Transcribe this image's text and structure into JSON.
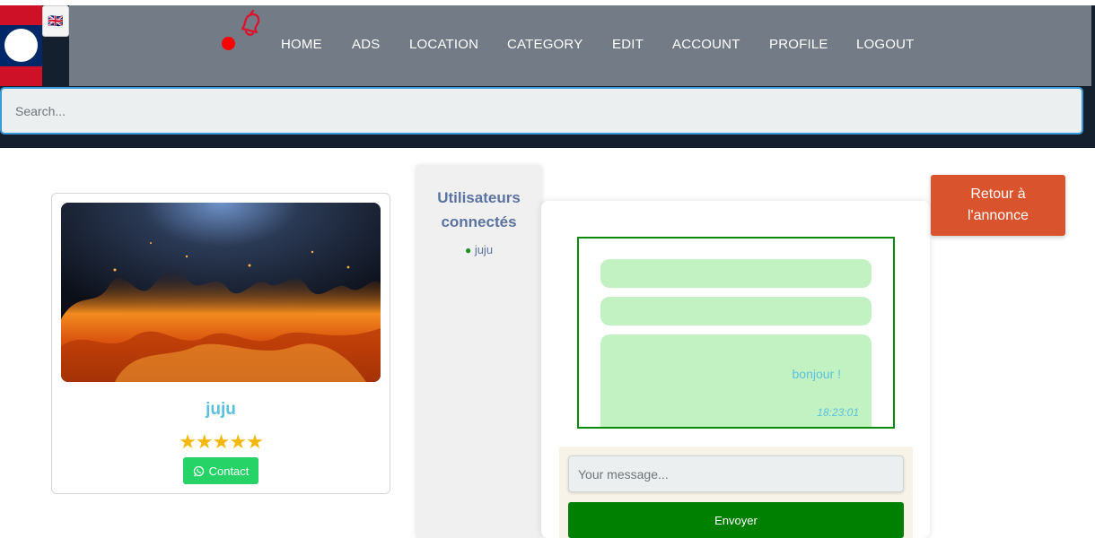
{
  "header": {
    "lang_flag": "🇬🇧",
    "nav": [
      "HOME",
      "ADS",
      "LOCATION",
      "CATEGORY",
      "EDIT",
      "ACCOUNT",
      "PROFILE",
      "LOGOUT"
    ],
    "colors": {
      "nav_bg": "#737b86",
      "bar_bg": "#14202e",
      "notification_dot": "#ff0000"
    }
  },
  "search": {
    "placeholder": "Search..."
  },
  "profile": {
    "name": "juju",
    "rating_stars": "★★★★★",
    "rating": 5,
    "contact_label": "Contact"
  },
  "users_panel": {
    "title": "Utilisateurs connectés",
    "users": [
      {
        "status_dot": "●",
        "name": "juju"
      }
    ]
  },
  "chat": {
    "messages": [
      {
        "text": "",
        "time": ""
      },
      {
        "text": "",
        "time": ""
      },
      {
        "text": "bonjour !",
        "time": "18:23:01"
      }
    ],
    "input_placeholder": "Your message...",
    "send_label": "Envoyer"
  },
  "back_button": {
    "label": "Retour à l'annonce"
  }
}
